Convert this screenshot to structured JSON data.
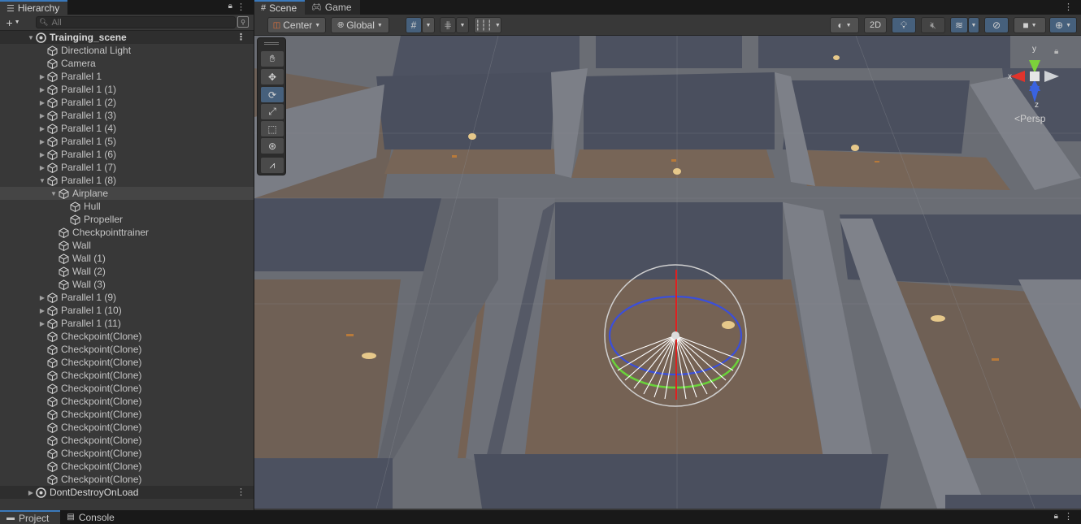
{
  "hierarchy": {
    "tab_label": "Hierarchy",
    "search_placeholder": "All",
    "scene_name": "Trainging_scene",
    "items": [
      {
        "label": "Directional Light",
        "level": 1,
        "expand": ""
      },
      {
        "label": "Camera",
        "level": 1,
        "expand": ""
      },
      {
        "label": "Parallel 1",
        "level": 1,
        "expand": "collapsed"
      },
      {
        "label": "Parallel 1 (1)",
        "level": 1,
        "expand": "collapsed"
      },
      {
        "label": "Parallel 1 (2)",
        "level": 1,
        "expand": "collapsed"
      },
      {
        "label": "Parallel 1 (3)",
        "level": 1,
        "expand": "collapsed"
      },
      {
        "label": "Parallel 1 (4)",
        "level": 1,
        "expand": "collapsed"
      },
      {
        "label": "Parallel 1 (5)",
        "level": 1,
        "expand": "collapsed"
      },
      {
        "label": "Parallel 1 (6)",
        "level": 1,
        "expand": "collapsed"
      },
      {
        "label": "Parallel 1 (7)",
        "level": 1,
        "expand": "collapsed"
      },
      {
        "label": "Parallel 1 (8)",
        "level": 1,
        "expand": "expanded"
      },
      {
        "label": "Airplane",
        "level": 2,
        "expand": "expanded",
        "selected": true
      },
      {
        "label": "Hull",
        "level": 3,
        "expand": ""
      },
      {
        "label": "Propeller",
        "level": 3,
        "expand": ""
      },
      {
        "label": "Checkpointtrainer",
        "level": 2,
        "expand": ""
      },
      {
        "label": "Wall",
        "level": 2,
        "expand": ""
      },
      {
        "label": "Wall (1)",
        "level": 2,
        "expand": ""
      },
      {
        "label": "Wall (2)",
        "level": 2,
        "expand": ""
      },
      {
        "label": "Wall (3)",
        "level": 2,
        "expand": ""
      },
      {
        "label": "Parallel 1 (9)",
        "level": 1,
        "expand": "collapsed"
      },
      {
        "label": "Parallel 1 (10)",
        "level": 1,
        "expand": "collapsed"
      },
      {
        "label": "Parallel 1 (11)",
        "level": 1,
        "expand": "collapsed"
      },
      {
        "label": "Checkpoint(Clone)",
        "level": 1,
        "expand": ""
      },
      {
        "label": "Checkpoint(Clone)",
        "level": 1,
        "expand": ""
      },
      {
        "label": "Checkpoint(Clone)",
        "level": 1,
        "expand": ""
      },
      {
        "label": "Checkpoint(Clone)",
        "level": 1,
        "expand": ""
      },
      {
        "label": "Checkpoint(Clone)",
        "level": 1,
        "expand": ""
      },
      {
        "label": "Checkpoint(Clone)",
        "level": 1,
        "expand": ""
      },
      {
        "label": "Checkpoint(Clone)",
        "level": 1,
        "expand": ""
      },
      {
        "label": "Checkpoint(Clone)",
        "level": 1,
        "expand": ""
      },
      {
        "label": "Checkpoint(Clone)",
        "level": 1,
        "expand": ""
      },
      {
        "label": "Checkpoint(Clone)",
        "level": 1,
        "expand": ""
      },
      {
        "label": "Checkpoint(Clone)",
        "level": 1,
        "expand": ""
      },
      {
        "label": "Checkpoint(Clone)",
        "level": 1,
        "expand": ""
      }
    ],
    "dont_destroy": "DontDestroyOnLoad"
  },
  "scene": {
    "tabs": [
      {
        "label": "Scene",
        "active": true
      },
      {
        "label": "Game",
        "active": false
      }
    ],
    "pivot_label": "Center",
    "space_label": "Global",
    "mode_2d": "2D",
    "persp_label": "Persp",
    "axes": {
      "x": "x",
      "y": "y",
      "z": "z"
    }
  },
  "bottom_tabs": [
    {
      "label": "Project"
    },
    {
      "label": "Console"
    }
  ],
  "colors": {
    "accent": "#3a79bb",
    "selected_tool": "#46607c",
    "panel": "#383838"
  }
}
